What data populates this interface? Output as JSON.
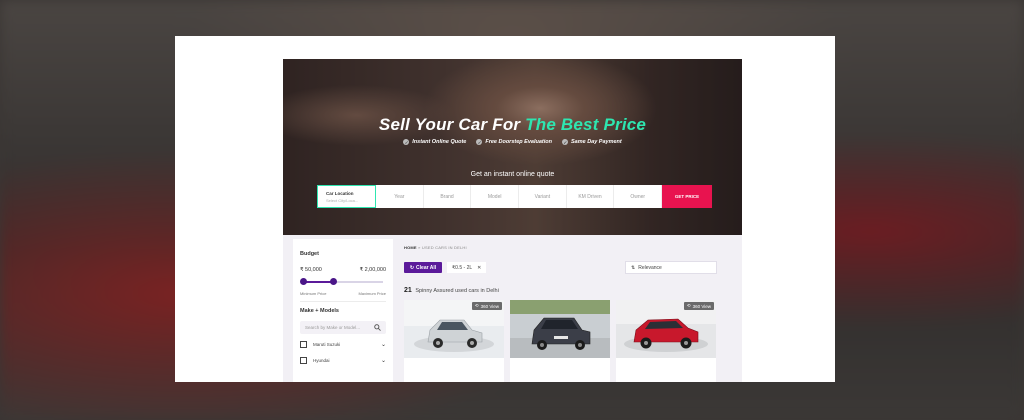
{
  "hero": {
    "title_plain": "Sell Your Car For ",
    "title_accent": "The Best Price",
    "usps": [
      "Instant Online Quote",
      "Free Doorstep Evaluation",
      "Same Day Payment"
    ],
    "quote_label": "Get an instant online quote",
    "quote_bar": {
      "location_label": "Car Location",
      "location_placeholder": "Select City/Loca...",
      "fields": [
        "Year",
        "Brand",
        "Model",
        "Variant",
        "KM Driven",
        "Owner"
      ],
      "button": "GET PRICE"
    }
  },
  "sidebar": {
    "budget_title": "Budget",
    "price_min": "₹ 50,000",
    "price_max": "₹ 2,00,000",
    "range_min_label": "Minimum Price",
    "range_max_label": "Maximum Price",
    "make_title": "Make + Models",
    "search_placeholder": "Search by Make or Model...",
    "makes": [
      "Maruti Suzuki",
      "Hyundai"
    ]
  },
  "listing": {
    "breadcrumb_home": "HOME",
    "breadcrumb_sep": "»",
    "breadcrumb_current": "USED CARS IN DELHI",
    "clear_all": "Clear All",
    "chip": "₹0.5 - 2L",
    "sort": "Relevance",
    "count": "21",
    "count_text": "Spinny Assured used cars in Delhi",
    "view_badge": "360 View"
  },
  "colors": {
    "accent_green": "#2ee6b0",
    "cta_red": "#e8134f",
    "brand_purple": "#5b1a9a"
  }
}
